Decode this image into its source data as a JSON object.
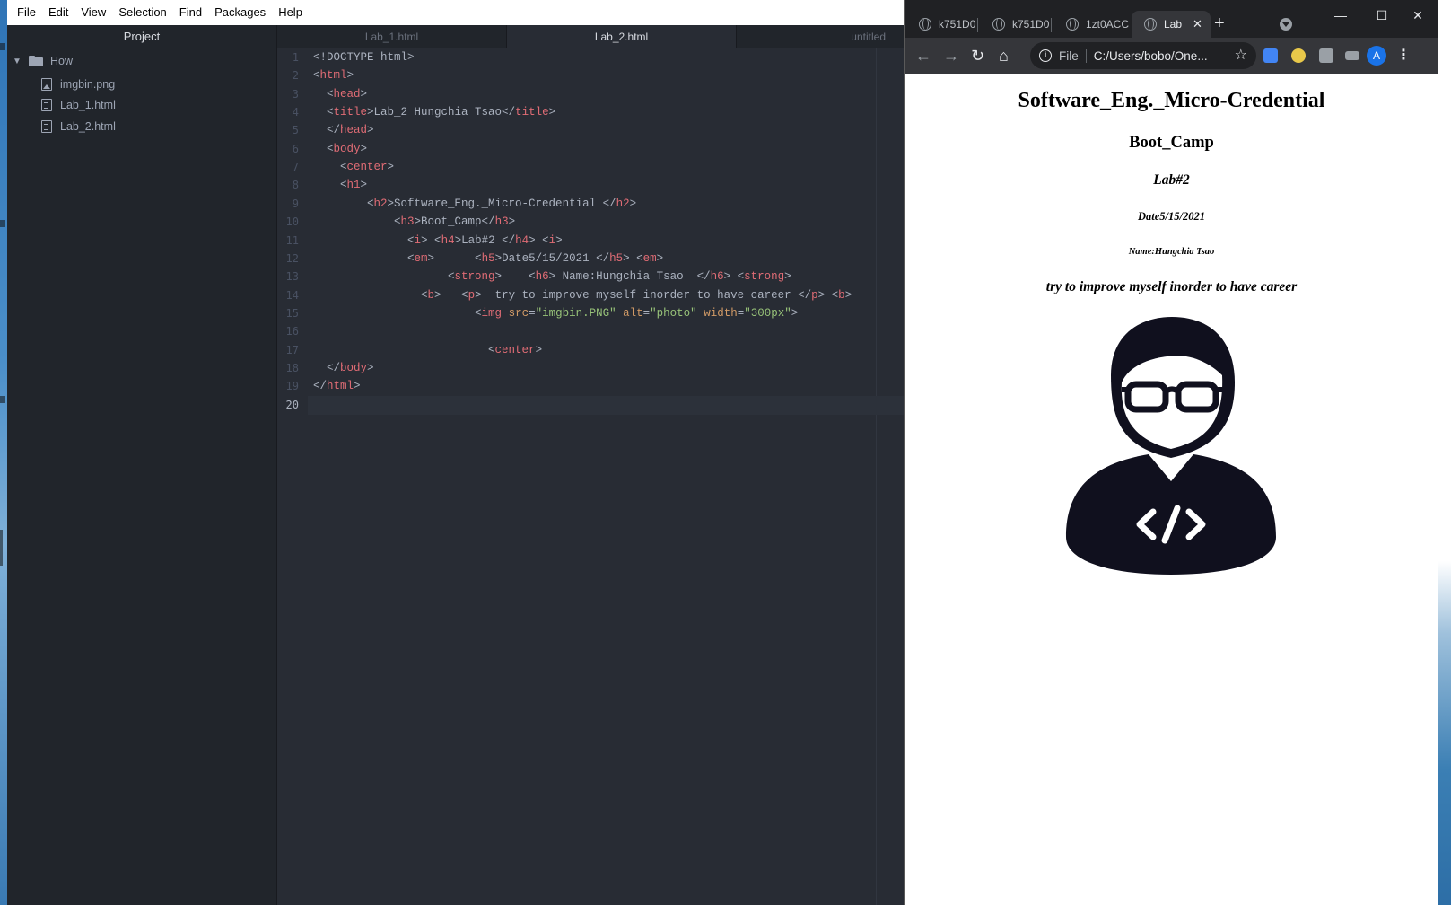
{
  "editor": {
    "menu": [
      "File",
      "Edit",
      "View",
      "Selection",
      "Find",
      "Packages",
      "Help"
    ],
    "sidebar": {
      "title": "Project",
      "folder": "How",
      "files": [
        "imgbin.png",
        "Lab_1.html",
        "Lab_2.html"
      ]
    },
    "tabs": [
      "Lab_1.html",
      "Lab_2.html",
      "untitled"
    ],
    "active_tab": "Lab_2.html",
    "cursor_line": 20,
    "lines": [
      [
        [
          "p",
          "<!DOCTYPE html>"
        ]
      ],
      [
        [
          "p",
          "<"
        ],
        [
          "t",
          "html"
        ],
        [
          "p",
          ">"
        ]
      ],
      [
        [
          "p",
          "  <"
        ],
        [
          "t",
          "head"
        ],
        [
          "p",
          ">"
        ]
      ],
      [
        [
          "p",
          "  <"
        ],
        [
          "t",
          "title"
        ],
        [
          "p",
          ">Lab_2 Hungchia Tsao</"
        ],
        [
          "t",
          "title"
        ],
        [
          "p",
          ">"
        ]
      ],
      [
        [
          "p",
          "  </"
        ],
        [
          "t",
          "head"
        ],
        [
          "p",
          ">"
        ]
      ],
      [
        [
          "p",
          "  <"
        ],
        [
          "t",
          "body"
        ],
        [
          "p",
          ">"
        ]
      ],
      [
        [
          "p",
          "    <"
        ],
        [
          "t",
          "center"
        ],
        [
          "p",
          ">"
        ]
      ],
      [
        [
          "p",
          "    <"
        ],
        [
          "t",
          "h1"
        ],
        [
          "p",
          ">"
        ]
      ],
      [
        [
          "p",
          "        <"
        ],
        [
          "t",
          "h2"
        ],
        [
          "p",
          ">Software_Eng._Micro-Credential </"
        ],
        [
          "t",
          "h2"
        ],
        [
          "p",
          ">"
        ]
      ],
      [
        [
          "p",
          "            <"
        ],
        [
          "t",
          "h3"
        ],
        [
          "p",
          ">Boot_Camp</"
        ],
        [
          "t",
          "h3"
        ],
        [
          "p",
          ">"
        ]
      ],
      [
        [
          "p",
          "              <"
        ],
        [
          "t",
          "i"
        ],
        [
          "p",
          "> <"
        ],
        [
          "t",
          "h4"
        ],
        [
          "p",
          ">Lab#2 </"
        ],
        [
          "t",
          "h4"
        ],
        [
          "p",
          "> <"
        ],
        [
          "t",
          "i"
        ],
        [
          "p",
          ">"
        ]
      ],
      [
        [
          "p",
          "              <"
        ],
        [
          "t",
          "em"
        ],
        [
          "p",
          ">      <"
        ],
        [
          "t",
          "h5"
        ],
        [
          "p",
          ">Date5/15/2021 </"
        ],
        [
          "t",
          "h5"
        ],
        [
          "p",
          "> <"
        ],
        [
          "t",
          "em"
        ],
        [
          "p",
          ">"
        ]
      ],
      [
        [
          "p",
          "                    <"
        ],
        [
          "t",
          "strong"
        ],
        [
          "p",
          ">    <"
        ],
        [
          "t",
          "h6"
        ],
        [
          "p",
          "> Name:Hungchia Tsao  </"
        ],
        [
          "t",
          "h6"
        ],
        [
          "p",
          "> <"
        ],
        [
          "t",
          "strong"
        ],
        [
          "p",
          ">"
        ]
      ],
      [
        [
          "p",
          "                <"
        ],
        [
          "t",
          "b"
        ],
        [
          "p",
          ">   <"
        ],
        [
          "t",
          "p"
        ],
        [
          "p",
          ">  try to improve myself inorder to have career </"
        ],
        [
          "t",
          "p"
        ],
        [
          "p",
          "> <"
        ],
        [
          "t",
          "b"
        ],
        [
          "p",
          ">"
        ]
      ],
      [
        [
          "p",
          "                        <"
        ],
        [
          "t",
          "img"
        ],
        [
          "p",
          " "
        ],
        [
          "a",
          "src"
        ],
        [
          "p",
          "="
        ],
        [
          "s",
          "\"imgbin.PNG\""
        ],
        [
          "p",
          " "
        ],
        [
          "a",
          "alt"
        ],
        [
          "p",
          "="
        ],
        [
          "s",
          "\"photo\""
        ],
        [
          "p",
          " "
        ],
        [
          "a",
          "width"
        ],
        [
          "p",
          "="
        ],
        [
          "s",
          "\"300px\""
        ],
        [
          "p",
          ">"
        ]
      ],
      [],
      [
        [
          "p",
          "                          <"
        ],
        [
          "t",
          "center"
        ],
        [
          "p",
          ">"
        ]
      ],
      [
        [
          "p",
          "  </"
        ],
        [
          "t",
          "body"
        ],
        [
          "p",
          ">"
        ]
      ],
      [
        [
          "p",
          "</"
        ],
        [
          "t",
          "html"
        ],
        [
          "p",
          ">"
        ]
      ],
      []
    ]
  },
  "browser": {
    "tabs": [
      "k751D0",
      "k751D0",
      "1zt0ACC",
      "Lab"
    ],
    "active_tab": "Lab",
    "close_glyph": "✕",
    "new_tab_glyph": "+",
    "address_chip": "File",
    "address": "C:/Users/bobo/One...",
    "avatar_letter": "A",
    "page": {
      "h2": "Software_Eng._Micro-Credential",
      "h3": "Boot_Camp",
      "h4": "Lab#2",
      "h5": "Date5/15/2021",
      "h6": "Name:Hungchia Tsao",
      "p": "try to improve myself inorder to have career",
      "img_alt": "photo"
    }
  },
  "colors": {
    "editor_bg": "#282c34",
    "sidebar_bg": "#21252b",
    "tag": "#e06c75",
    "string": "#98c379",
    "attribute": "#d19a66",
    "chrome_frame": "#202124",
    "avatar": "#1a73e8",
    "developer_icon": "#10101e"
  },
  "icons": {
    "folder": "folder-icon",
    "image_file": "image-file-icon",
    "text_file": "text-file-icon",
    "back": "back-arrow-icon",
    "forward": "forward-arrow-icon",
    "reload": "reload-icon",
    "home": "home-icon",
    "info": "info-icon",
    "star": "bookmark-star-icon",
    "translate": "translate-extension-icon",
    "extensions": "puzzle-icon",
    "menu": "kebab-menu-icon"
  }
}
